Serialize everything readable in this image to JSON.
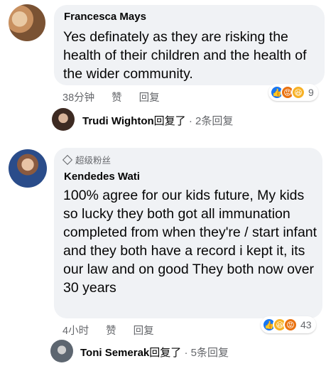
{
  "comments": [
    {
      "author": "Francesca Mays",
      "text": "Yes definately as they are risking the health of their children and the health of the wider community.",
      "time": "38分钟",
      "like_label": "赞",
      "reply_label": "回复",
      "reaction_count": "9",
      "reactions": [
        "like",
        "angry",
        "haha"
      ],
      "reply_summary": {
        "author": "Trudi Wighton",
        "verb": "回复了",
        "count": " · 2条回复"
      }
    },
    {
      "badge": "超级粉丝",
      "author": "Kendedes Wati",
      "text": "100% agree for our kids future, My kids so lucky they both got all immunation completed from when they're / start infant and they both have a record i kept it, its our law and on good   They both now over 30 years",
      "time": "4小时",
      "like_label": "赞",
      "reply_label": "回复",
      "reaction_count": "43",
      "reactions": [
        "like",
        "haha",
        "angry"
      ],
      "reply_summary": {
        "author": "Toni Semerak",
        "verb": "回复了",
        "count": " · 5条回复"
      }
    }
  ],
  "colors": {
    "bubble": "#f0f2f5",
    "meta": "#65676b",
    "like": "#1877f2",
    "angry": "#e9710f",
    "haha": "#f7b125"
  }
}
